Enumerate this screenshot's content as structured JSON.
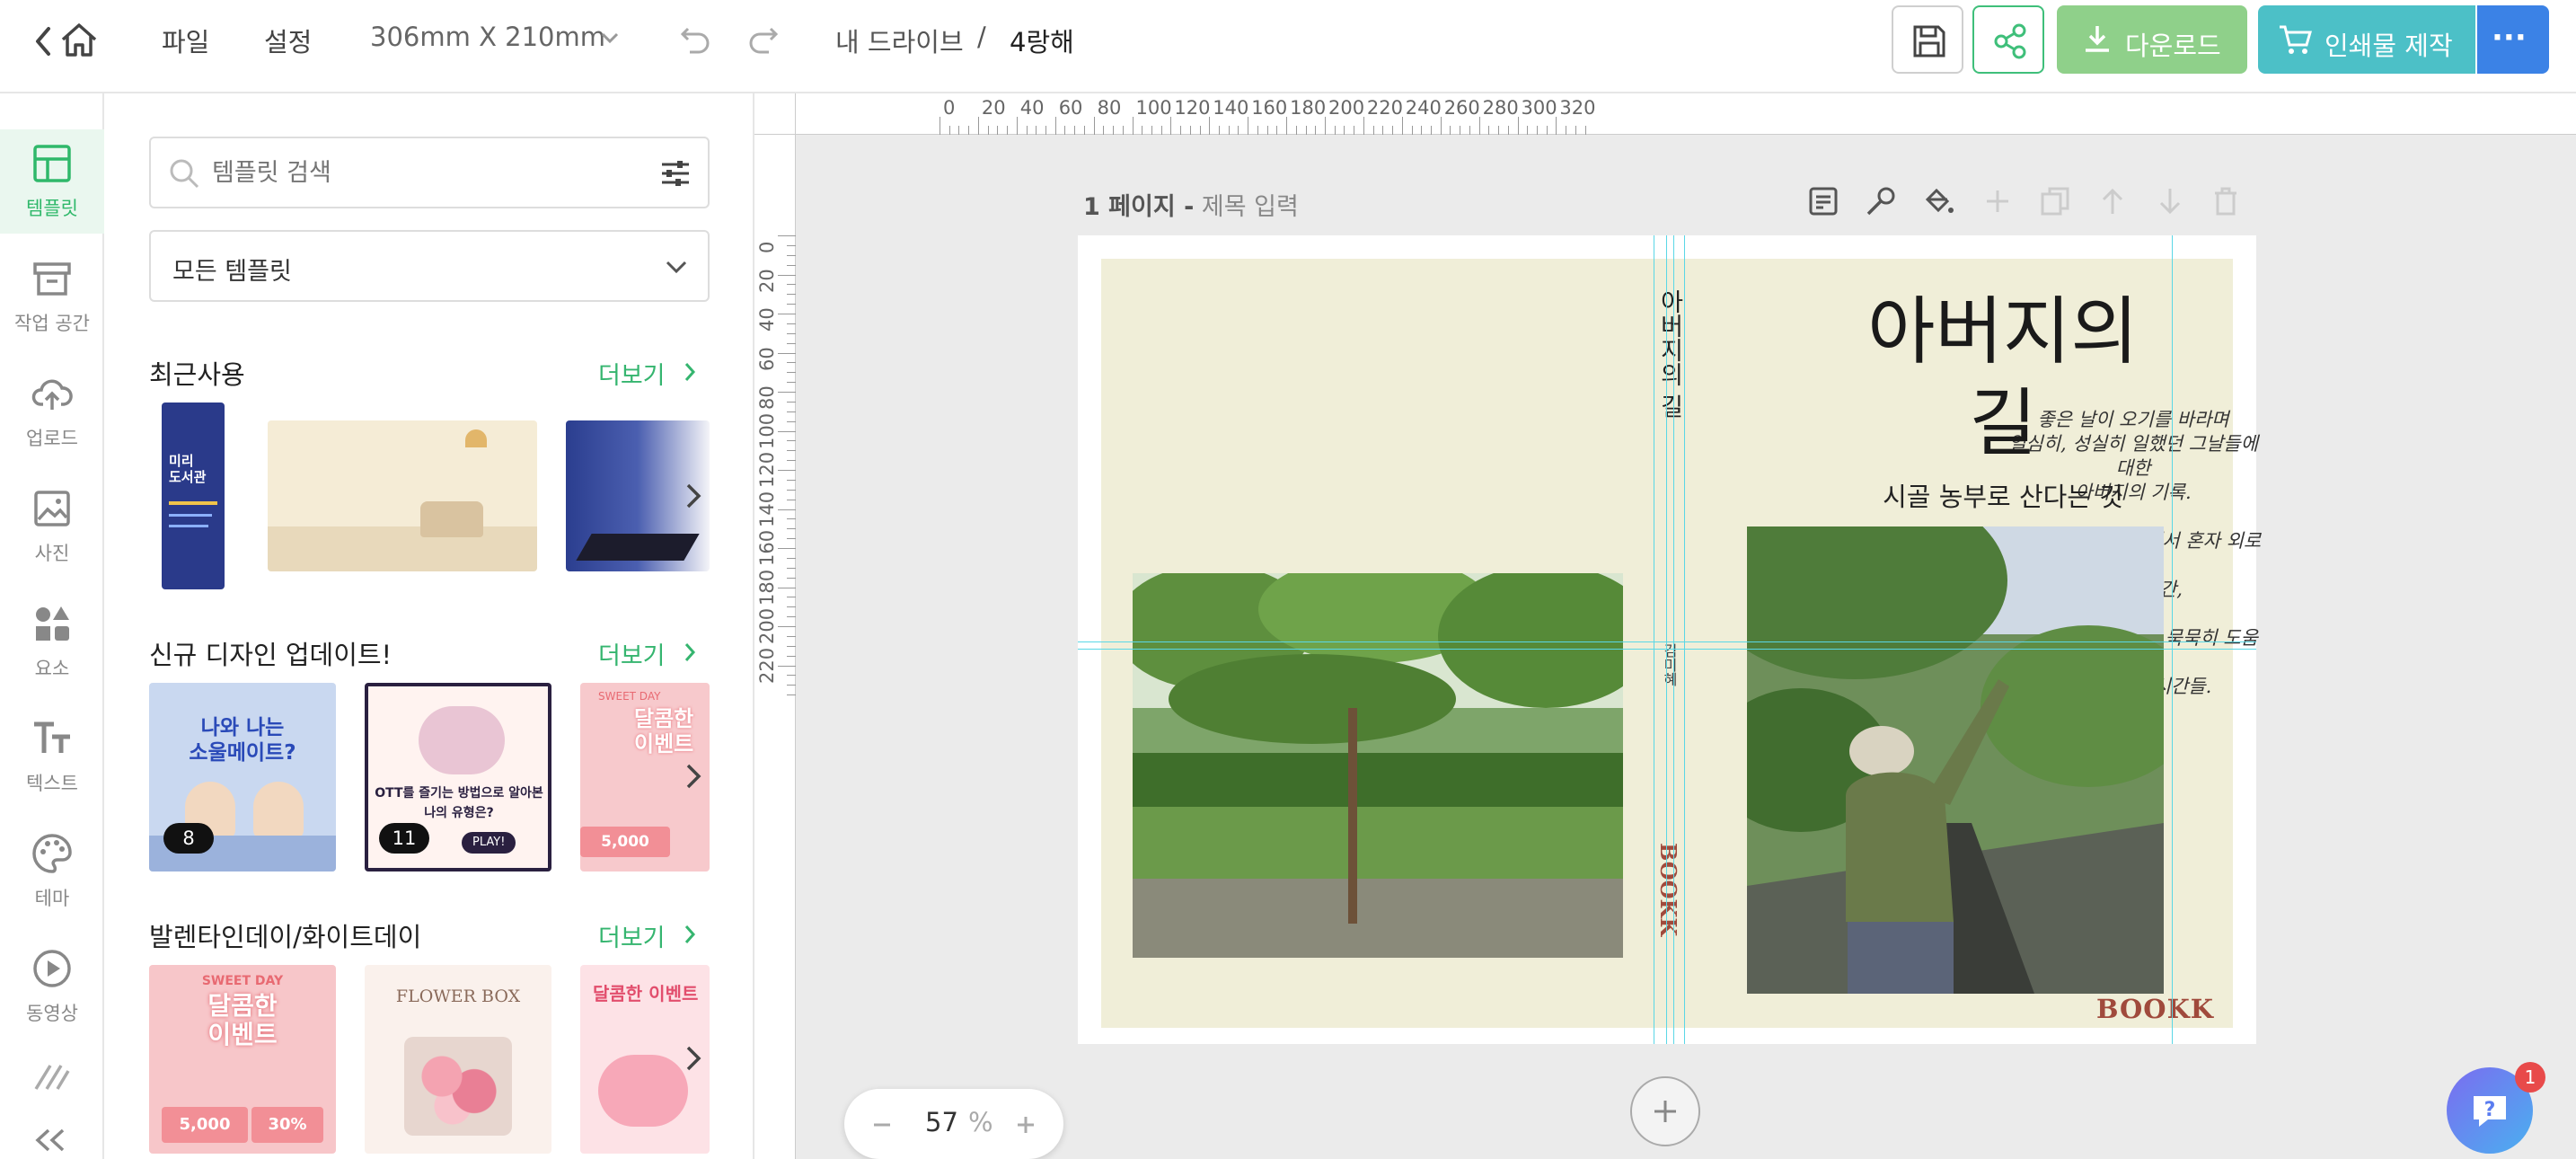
{
  "topbar": {
    "menu_file": "파일",
    "menu_settings": "설정",
    "page_size": "306mm X 210mm",
    "breadcrumb_root": "내 드라이브",
    "breadcrumb_sep": "/",
    "breadcrumb_doc": "4랑해",
    "download_label": "다운로드",
    "print_label": "인쇄물 제작",
    "more_label": "···",
    "accent_green": "#8fd08a",
    "accent_teal": "#4cc0c7",
    "accent_blue": "#3b82e6"
  },
  "rail": {
    "items": [
      {
        "label": "템플릿",
        "icon": "layout-icon"
      },
      {
        "label": "작업 공간",
        "icon": "archive-icon"
      },
      {
        "label": "업로드",
        "icon": "cloud-upload-icon"
      },
      {
        "label": "사진",
        "icon": "image-icon"
      },
      {
        "label": "요소",
        "icon": "shapes-icon"
      },
      {
        "label": "텍스트",
        "icon": "text-icon"
      },
      {
        "label": "테마",
        "icon": "palette-icon"
      },
      {
        "label": "동영상",
        "icon": "play-icon"
      }
    ]
  },
  "panel": {
    "search_placeholder": "템플릿 검색",
    "category_select": "모든 템플릿",
    "more_label": "더보기",
    "sections": [
      {
        "title": "최근사용"
      },
      {
        "title": "신규 디자인 업데이트!"
      },
      {
        "title": "발렌타인데이/화이트데이"
      }
    ],
    "badges": [
      "8",
      "11"
    ],
    "thumb_texts": {
      "library_title": "미리\n도서관",
      "quiz_title": "나와 나는\n소울메이트?",
      "ott_title": "OTT를 즐기는 방법으로 알아본\n나의 유형은?",
      "ott_play": "PLAY!",
      "sweet_day": "SWEET DAY",
      "sweet_event": "달콤한\n이벤트",
      "price_5000": "5,000",
      "discount_30": "30%",
      "flower_box": "FLOWER BOX"
    }
  },
  "canvas": {
    "page_label": "1 페이지 -",
    "page_title_placeholder": "제목 입력",
    "ruler_h": [
      "0",
      "20",
      "40",
      "60",
      "80",
      "100",
      "120",
      "140",
      "160",
      "180",
      "200",
      "220",
      "240",
      "260",
      "280",
      "300",
      "320"
    ],
    "ruler_v": [
      "0",
      "20",
      "40",
      "60",
      "80",
      "100",
      "120",
      "140",
      "160",
      "180",
      "200",
      "220"
    ],
    "zoom_value": "57",
    "zoom_unit": "%"
  },
  "book": {
    "poem": "좋은 날이 오기를 바라며\n열심히, 성실히 일했던 그날들에 대한\n아버지의 기록.\n\n그리고 그 길 과정에서 혼자 외로이\n버텼을 시간,\n\n또는 누군가 곁에서 묵묵히 도움을 주며\n함께 보냈을 시간들.",
    "spine_title": "아버지의 길",
    "spine_author": "김미혜",
    "spine_logo": "BOOKK",
    "front_title_line1": "아버지의",
    "front_title_line2": "길",
    "front_subtitle": "시골 농부로 산다는 것",
    "front_logo": "BOOKK",
    "paper_color": "#f0eed8"
  },
  "help": {
    "notification_count": "1"
  }
}
